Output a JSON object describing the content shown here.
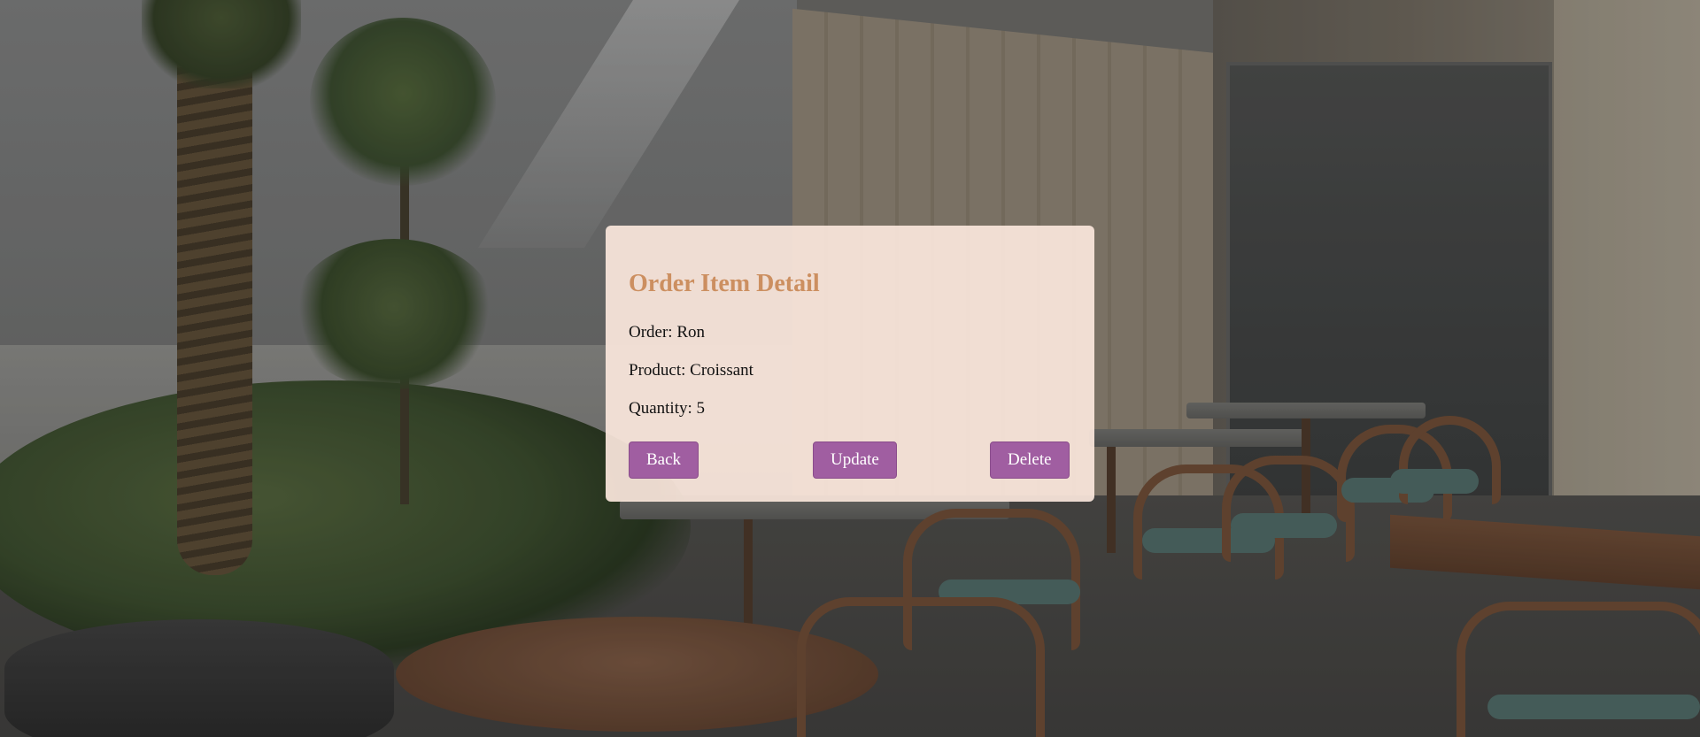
{
  "card": {
    "title": "Order Item Detail",
    "fields": [
      {
        "label": "Order: ",
        "value": "Ron"
      },
      {
        "label": "Product: ",
        "value": "Croissant"
      },
      {
        "label": "Quantity: ",
        "value": "5"
      }
    ],
    "buttons": {
      "back": "Back",
      "update": "Update",
      "delete": "Delete"
    }
  },
  "colors": {
    "title": "#cc8f60",
    "button": "#a05ea1",
    "card_background": "#fae6dc"
  }
}
